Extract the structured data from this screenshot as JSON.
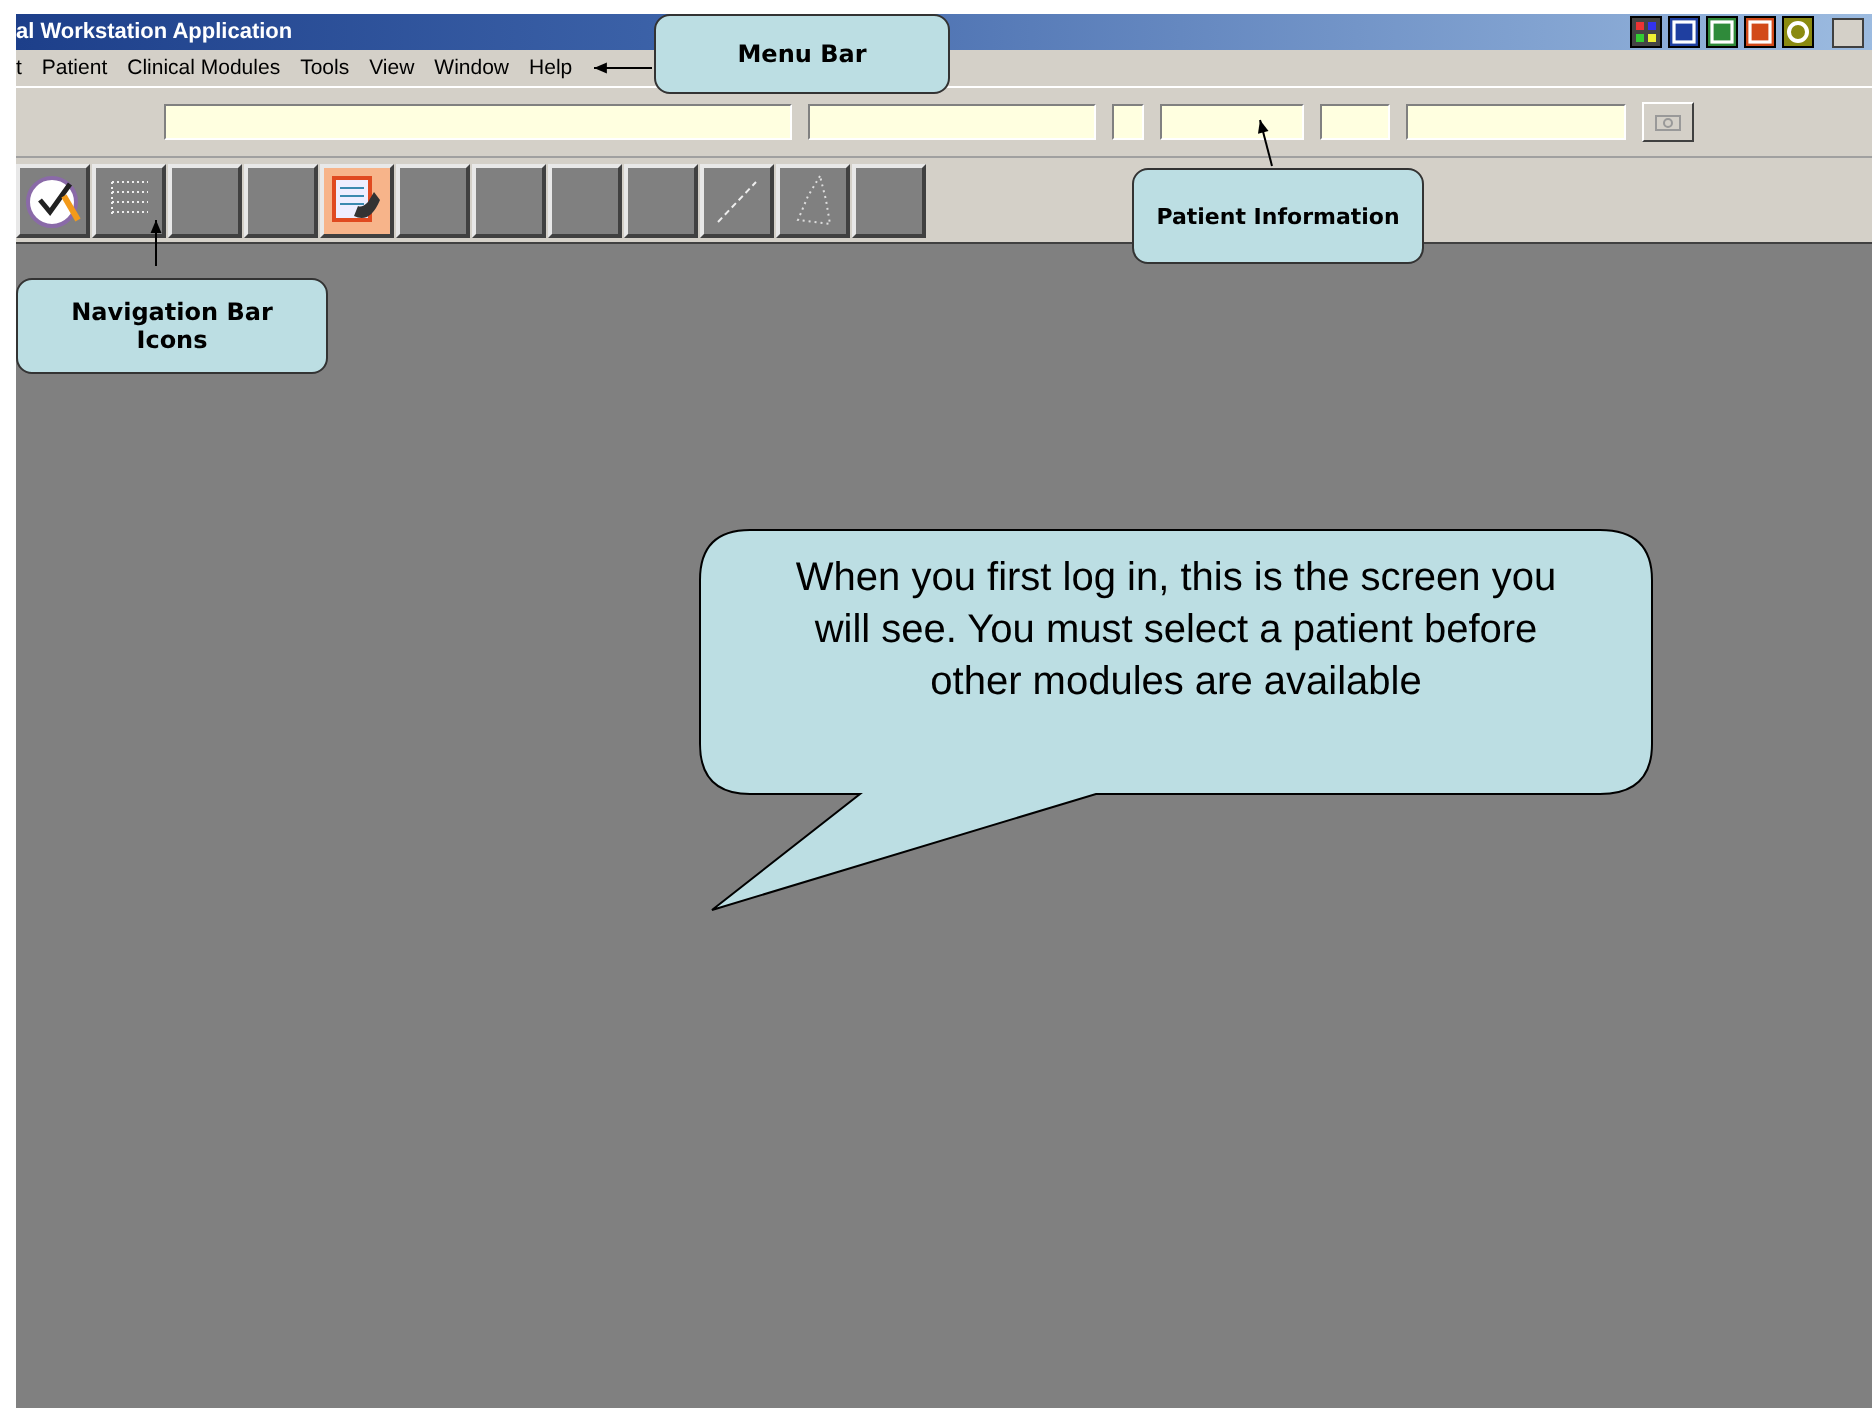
{
  "window": {
    "title": "al Workstation Application"
  },
  "tray_icons": [
    {
      "kind": "grid"
    },
    {
      "kind": "word"
    },
    {
      "kind": "sheet"
    },
    {
      "kind": "slides"
    },
    {
      "kind": "clock"
    }
  ],
  "menu": [
    "t",
    "Patient",
    "Clinical Modules",
    "Tools",
    "View",
    "Window",
    "Help"
  ],
  "nav_buttons": [
    {
      "kind": "clock"
    },
    {
      "kind": "dotted-list"
    },
    {
      "kind": "blank"
    },
    {
      "kind": "blank"
    },
    {
      "kind": "notes"
    },
    {
      "kind": "blank"
    },
    {
      "kind": "blank"
    },
    {
      "kind": "blank"
    },
    {
      "kind": "blank"
    },
    {
      "kind": "line"
    },
    {
      "kind": "dotted-shape"
    },
    {
      "kind": "blank"
    }
  ],
  "callouts": [
    {
      "kind": "menu",
      "text": "Menu Bar"
    },
    {
      "kind": "patient",
      "text": "Patient Information"
    },
    {
      "kind": "nav",
      "text": "Navigation Bar Icons"
    }
  ],
  "speech_bubble": {
    "text": "When you first log in, this is the screen you will see. You must select a patient before other modules are available"
  }
}
